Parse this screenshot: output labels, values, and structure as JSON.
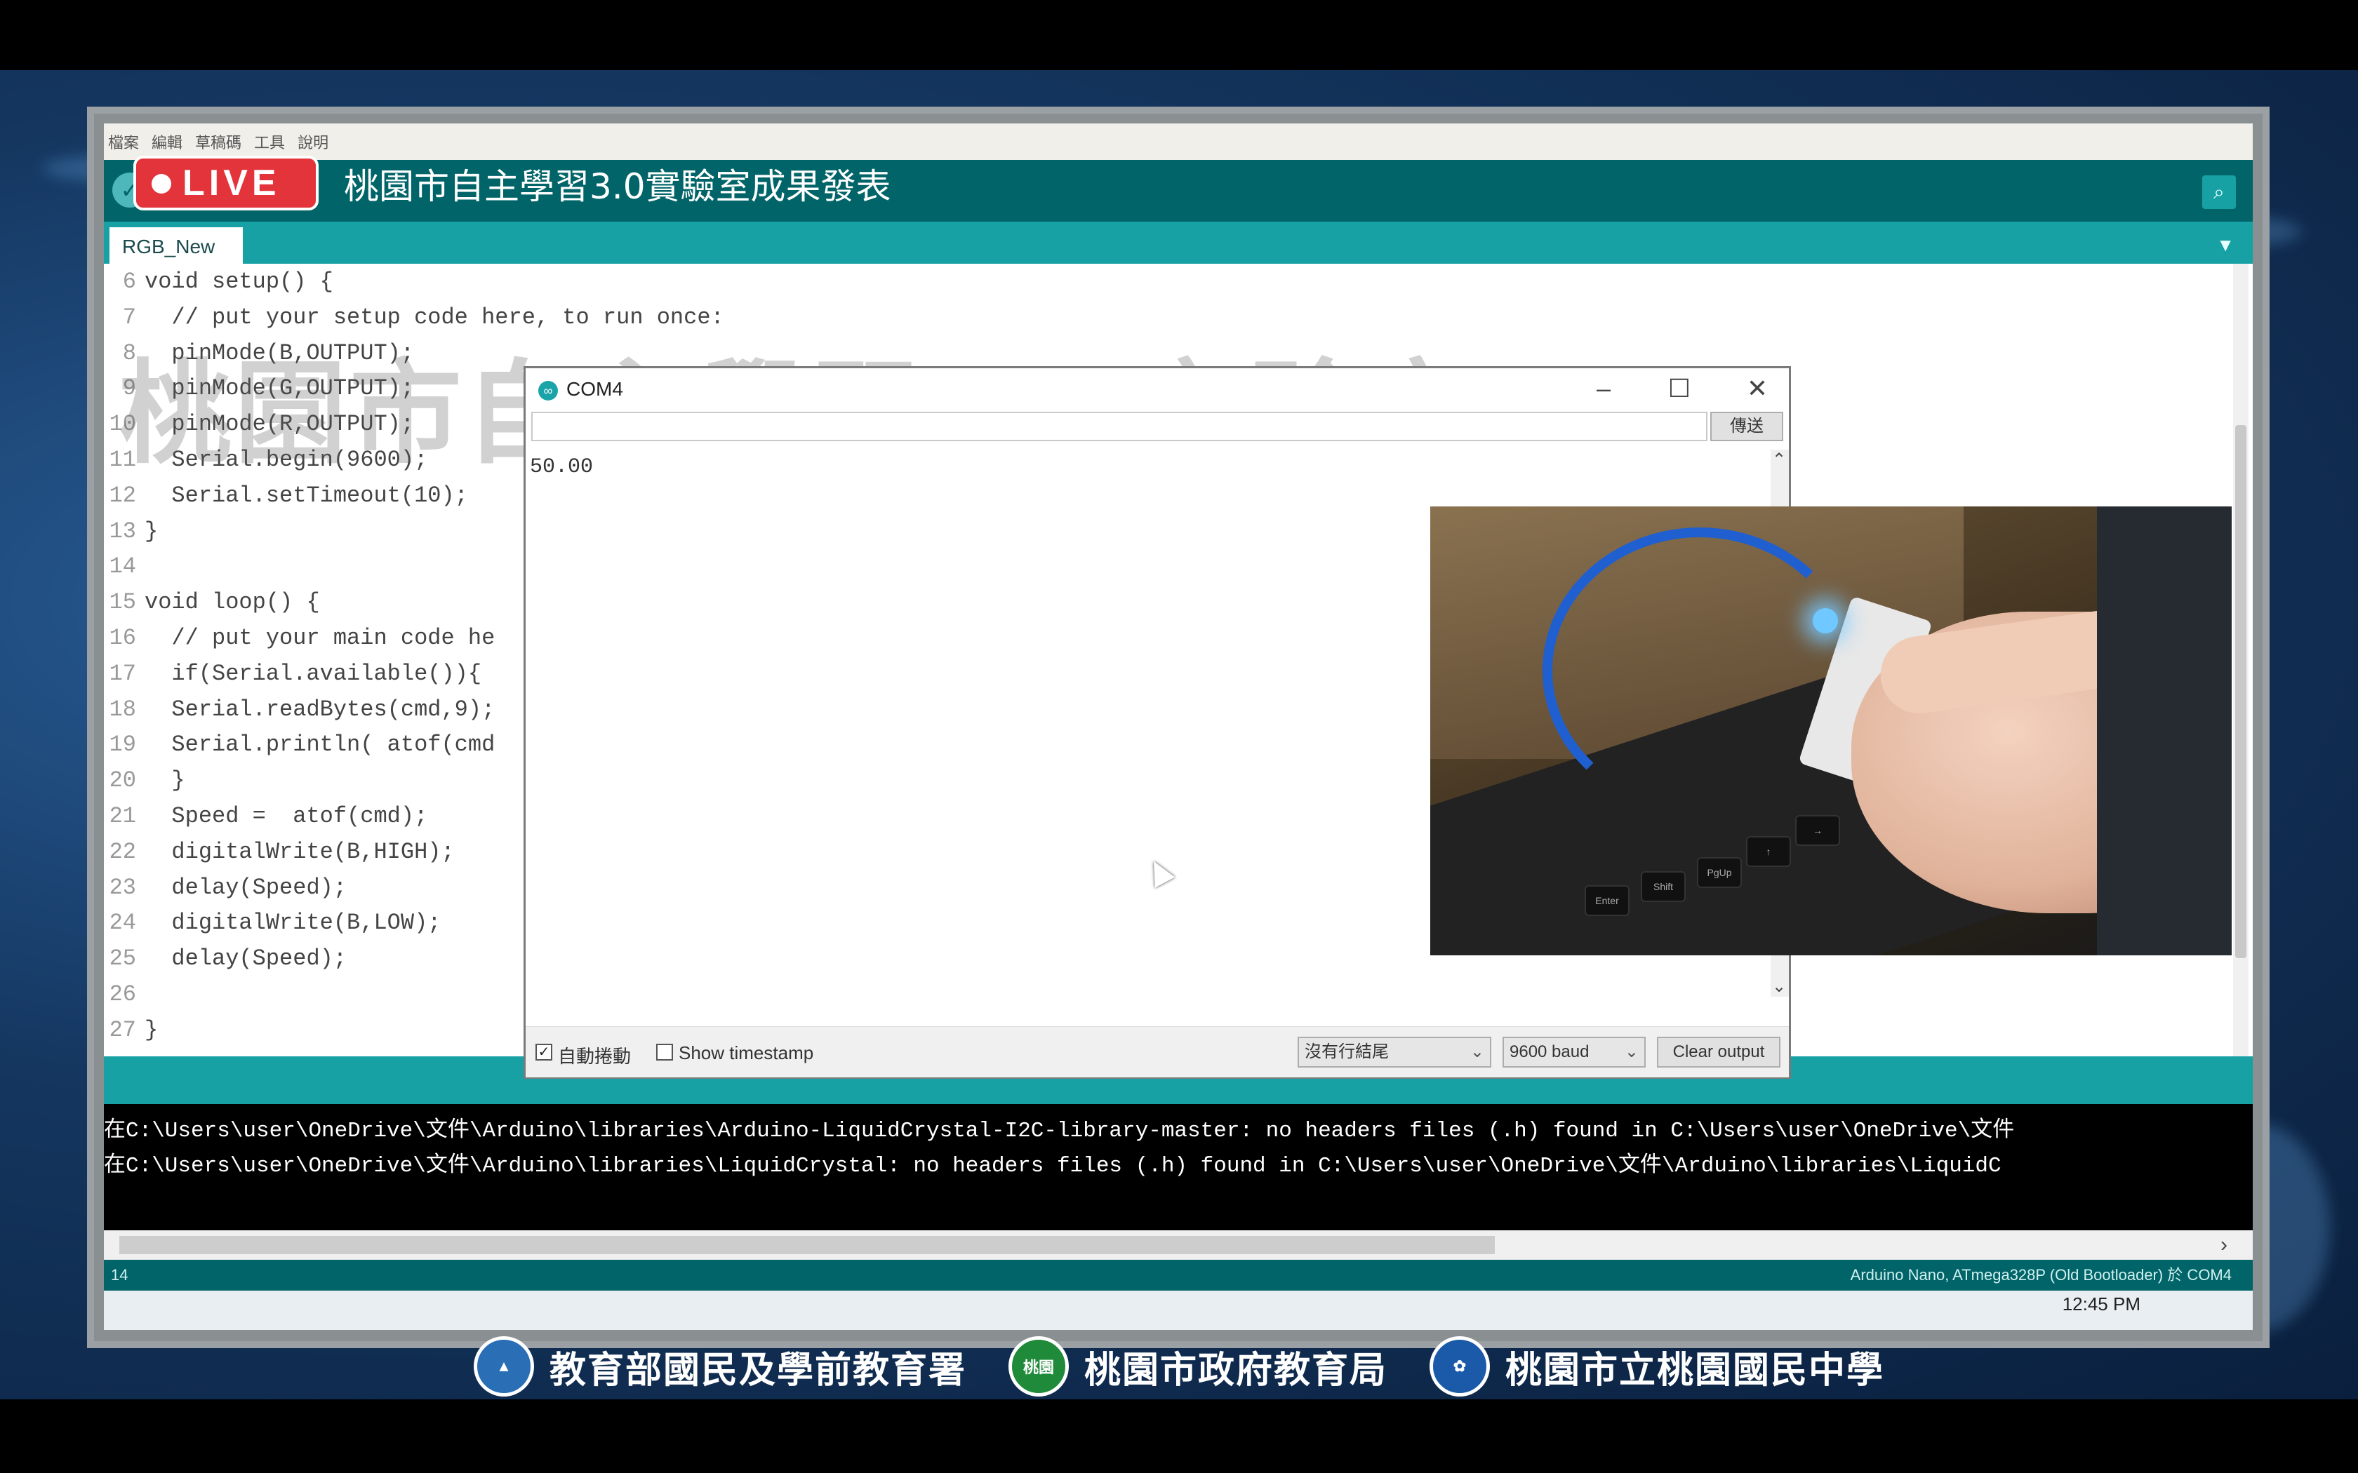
{
  "live_badge": {
    "label": "LIVE"
  },
  "stream_title": "桃園市自主學習3.0實驗室成果發表",
  "watermark": "桃園市自主學習3.0實驗室",
  "ide": {
    "menu": [
      "檔案",
      "編輯",
      "草稿碼",
      "工具",
      "說明"
    ],
    "tab_name": "RGB_New",
    "code_lines": [
      {
        "n": "6",
        "text": "void setup() {"
      },
      {
        "n": "7",
        "text": "  // put your setup code here, to run once:"
      },
      {
        "n": "8",
        "text": "  pinMode(B,OUTPUT);"
      },
      {
        "n": "9",
        "text": "  pinMode(G,OUTPUT);"
      },
      {
        "n": "10",
        "text": "  pinMode(R,OUTPUT);"
      },
      {
        "n": "11",
        "text": "  Serial.begin(9600);"
      },
      {
        "n": "12",
        "text": "  Serial.setTimeout(10);"
      },
      {
        "n": "13",
        "text": "}"
      },
      {
        "n": "14",
        "text": ""
      },
      {
        "n": "15",
        "text": "void loop() {"
      },
      {
        "n": "16",
        "text": "  // put your main code he"
      },
      {
        "n": "17",
        "text": "  if(Serial.available()){"
      },
      {
        "n": "18",
        "text": "  Serial.readBytes(cmd,9);"
      },
      {
        "n": "19",
        "text": "  Serial.println( atof(cmd"
      },
      {
        "n": "20",
        "text": "  }"
      },
      {
        "n": "21",
        "text": "  Speed =  atof(cmd);"
      },
      {
        "n": "22",
        "text": "  digitalWrite(B,HIGH);"
      },
      {
        "n": "23",
        "text": "  delay(Speed);"
      },
      {
        "n": "24",
        "text": "  digitalWrite(B,LOW);"
      },
      {
        "n": "25",
        "text": "  delay(Speed);"
      },
      {
        "n": "26",
        "text": ""
      },
      {
        "n": "27",
        "text": "}"
      }
    ],
    "console_lines": [
      "在C:\\Users\\user\\OneDrive\\文件\\Arduino\\libraries\\Arduino-LiquidCrystal-I2C-library-master: no headers files (.h) found in C:\\Users\\user\\OneDrive\\文件",
      "在C:\\Users\\user\\OneDrive\\文件\\Arduino\\libraries\\LiquidCrystal: no headers files (.h) found in C:\\Users\\user\\OneDrive\\文件\\Arduino\\libraries\\LiquidC"
    ],
    "status_line": "14",
    "board_info": "Arduino Nano, ATmega328P (Old Bootloader) 於 COM4",
    "clock": "12:45 PM"
  },
  "serial_monitor": {
    "title": "COM4",
    "send_label": "傳送",
    "output": "50.00",
    "autoscroll_label": "自動捲動",
    "autoscroll_checked": true,
    "timestamp_label": "Show timestamp",
    "timestamp_checked": false,
    "line_ending": "沒有行結尾",
    "baud": "9600 baud",
    "clear_label": "Clear output"
  },
  "sponsors": [
    {
      "name": "教育部國民及學前教育署",
      "logo_color": "#2a6fb5"
    },
    {
      "name": "桃園市政府教育局",
      "logo_color": "#1f8a3a",
      "logo_text": "桃園"
    },
    {
      "name": "桃園市立桃園國民中學",
      "logo_color": "#1b5aa8"
    }
  ]
}
